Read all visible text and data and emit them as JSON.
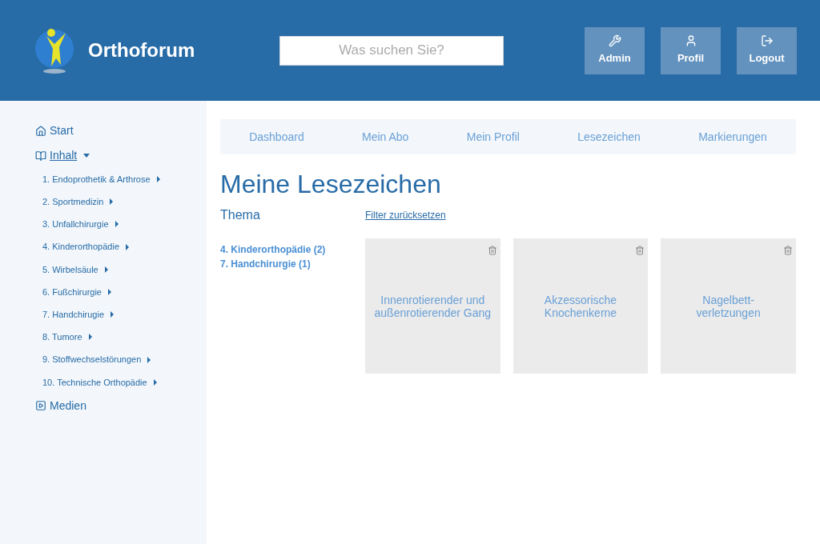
{
  "header": {
    "brand": "Orthoforum",
    "search": {
      "placeholder": "Was suchen Sie?"
    },
    "buttons": [
      {
        "kind": "wrench",
        "label": "Admin"
      },
      {
        "kind": "user",
        "label": "Profil"
      },
      {
        "kind": "logout",
        "label": "Logout"
      }
    ]
  },
  "sidebar": {
    "items": [
      {
        "kind": "home",
        "label": "Start",
        "expanded": false
      },
      {
        "kind": "book",
        "label": "Inhalt",
        "expanded": true,
        "children": [
          {
            "label": "1. Endoprothetik & Arthrose"
          },
          {
            "label": "2. Sportmedizin"
          },
          {
            "label": "3. Unfallchirurgie"
          },
          {
            "label": "4. Kinderorthopädie"
          },
          {
            "label": "5. Wirbelsäule"
          },
          {
            "label": "6. Fußchirurgie"
          },
          {
            "label": "7. Handchirugie"
          },
          {
            "label": "8. Tumore"
          },
          {
            "label": "9. Stoffwechselstörungen"
          },
          {
            "label": "10. Technische Orthopädie"
          }
        ]
      },
      {
        "kind": "play",
        "label": "Medien",
        "expanded": false
      }
    ]
  },
  "tabs": [
    "Dashboard",
    "Mein Abo",
    "Mein Profil",
    "Lesezeichen",
    "Markierungen"
  ],
  "heading": "Meine Lesezeichen",
  "filter": {
    "label": "Thema",
    "reset": "Filter zurücksetzen",
    "topics": [
      "4. Kinderorthopädie (2)",
      "7. Handchirurgie (1)"
    ]
  },
  "bookmarks": [
    {
      "title": "Innenrotierender und außenrotierender Gang"
    },
    {
      "title": "Akzessorische Knochenkerne"
    },
    {
      "title": "Nagelbett-\nverletzungen"
    }
  ]
}
